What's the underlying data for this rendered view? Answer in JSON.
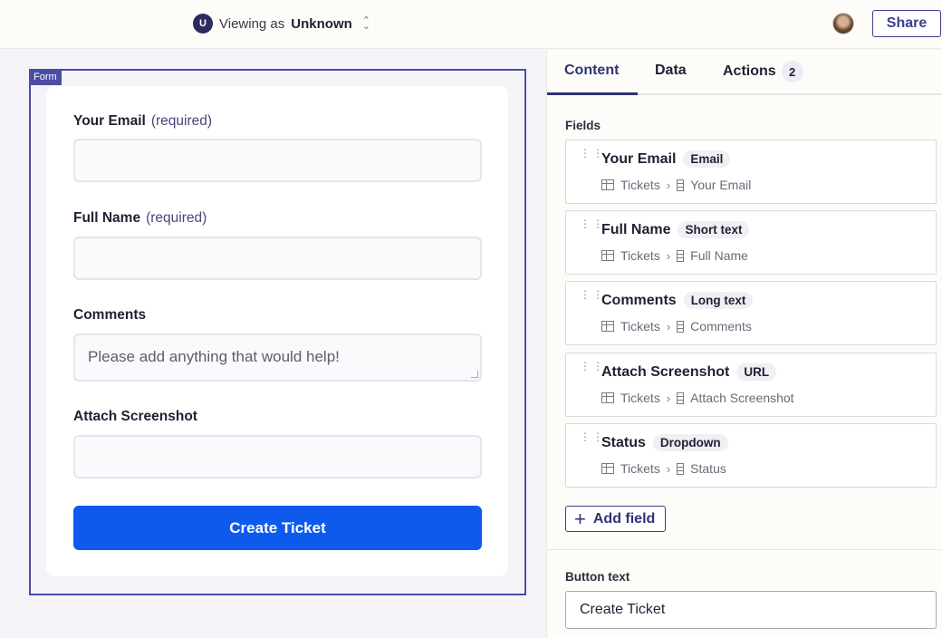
{
  "topbar": {
    "user_initial": "U",
    "viewing_prefix": "Viewing as",
    "viewing_user": "Unknown",
    "share_label": "Share"
  },
  "form": {
    "tag": "Form",
    "fields": [
      {
        "label": "Your Email",
        "required": "(required)"
      },
      {
        "label": "Full Name",
        "required": "(required)"
      },
      {
        "label": "Comments",
        "placeholder": "Please add anything that would help!"
      },
      {
        "label": "Attach Screenshot"
      }
    ],
    "submit_label": "Create Ticket"
  },
  "panel": {
    "tabs": [
      {
        "label": "Content"
      },
      {
        "label": "Data"
      },
      {
        "label": "Actions",
        "count": "2"
      }
    ],
    "fields_label": "Fields",
    "fields": [
      {
        "name": "Your Email",
        "type": "Email",
        "table": "Tickets",
        "column": "Your Email"
      },
      {
        "name": "Full Name",
        "type": "Short text",
        "table": "Tickets",
        "column": "Full Name"
      },
      {
        "name": "Comments",
        "type": "Long text",
        "table": "Tickets",
        "column": "Comments"
      },
      {
        "name": "Attach Screenshot",
        "type": "URL",
        "table": "Tickets",
        "column": "Attach Screenshot"
      },
      {
        "name": "Status",
        "type": "Dropdown",
        "table": "Tickets",
        "column": "Status"
      }
    ],
    "add_field_label": "Add field",
    "button_text_label": "Button text",
    "button_text_value": "Create Ticket"
  }
}
